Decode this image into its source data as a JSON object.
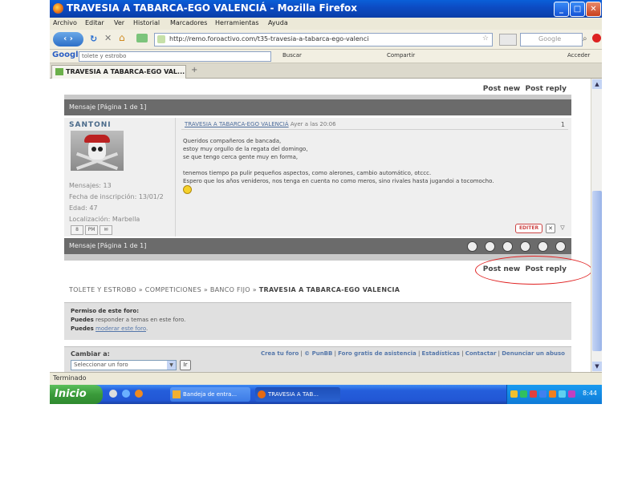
{
  "window": {
    "title": "TRAVESIA A TABARCA-EGO VALENCIÁ - Mozilla Firefox",
    "min": "_",
    "max": "□",
    "close": "✕"
  },
  "menu": [
    "Archivo",
    "Editar",
    "Ver",
    "Historial",
    "Marcadores",
    "Herramientas",
    "Ayuda"
  ],
  "nav": {
    "url": "http://remo.foroactivo.com/t35-travesia-a-tabarca-ego-valenci",
    "search_placeholder": "Google"
  },
  "google_bar": {
    "logo": "Google",
    "query": "tolete y estrobo",
    "buscar": "Buscar",
    "compartir": "Compartir",
    "acceder": "Acceder"
  },
  "tab": {
    "label": "TRAVESIA A TABARCA-EGO VAL..."
  },
  "forum": {
    "post_new": "Post new",
    "post_reply": "Post reply",
    "page_label_top": "Mensaje [Página 1 de 1]",
    "page_label_bottom": "Mensaje [Página 1 de 1]",
    "author": "SANTONI",
    "profile": {
      "messages": "Mensajes: 13",
      "joined": "Fecha de inscripción: 13/01/2",
      "age": "Edad: 47",
      "location": "Localización: Marbella"
    },
    "post_title": "TRAVESIA A TABARCA-EGO VALENCIÁ",
    "post_date": "Ayer a las 20:06",
    "post_number": "1",
    "message_lines": [
      "Queridos compañeros de bancada,",
      "estoy muy orgullo de la regata del domingo,",
      "se que tengo cerca gente muy en forma,",
      "tenemos tiempo pa pulir pequeños aspectos, como alerones, cambio automático, otccc.",
      "Espero que los años venideros, nos tenga en cuenta no como meros, sino rivales hasta jugandoi a tocomocho."
    ],
    "edit_label": "EDITER",
    "breadcrumb": "TOLETE Y ESTROBO » COMPETICIONES » BANCO FIJO »",
    "breadcrumb_current": "TRAVESIA A TABARCA-EGO VALENCIA",
    "perms_title": "Permiso de este foro:",
    "perms_line1_bold": "Puedes",
    "perms_line1": "responder a temas en este foro.",
    "perms_line2_bold": "Puedes",
    "perms_line2_link": "moderar este foro",
    "change_label": "Cambiar a:",
    "select_value": "Seleccionar un foro",
    "go": "Ir",
    "footer_links": [
      "Crea tu foro",
      "© PunBB",
      "Foro gratis de asistencia",
      "Estadísticas",
      "Contactar",
      "Denunciar un abuso"
    ]
  },
  "status": "Terminado",
  "taskbar": {
    "start": "Inicio",
    "btn1": "Bandeja de entra...",
    "btn2": "TRAVESIA A TAB...",
    "clock": "8:44"
  },
  "colors": {
    "titlebar": "#0c4cc4",
    "dark_bar": "#6b6b6b",
    "annotation_oval": "#e02020",
    "start_button": "#3a9a3a"
  }
}
